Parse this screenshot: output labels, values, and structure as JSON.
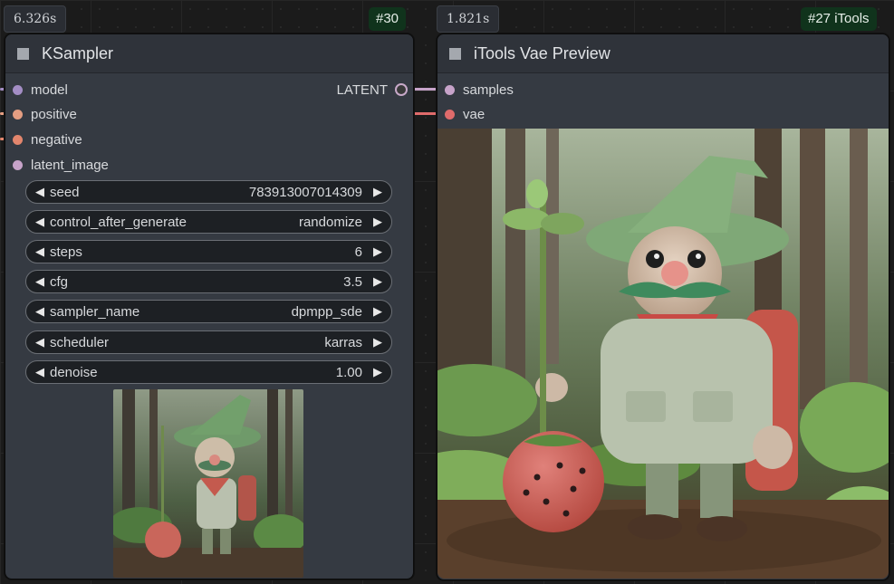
{
  "colors": {
    "model": "#a38dc4",
    "positive": "#e59e82",
    "negative": "#e3866d",
    "latent": "#c7a3c9",
    "vae": "#e06b6b",
    "id_badge_bg": "#10331c"
  },
  "ksampler": {
    "time": "6.326s",
    "id": "#30",
    "title": "KSampler",
    "inputs": [
      "model",
      "positive",
      "negative",
      "latent_image"
    ],
    "output": "LATENT",
    "widgets": [
      {
        "label": "seed",
        "value": "783913007014309"
      },
      {
        "label": "control_after_generate",
        "value": "randomize"
      },
      {
        "label": "steps",
        "value": "6"
      },
      {
        "label": "cfg",
        "value": "3.5"
      },
      {
        "label": "sampler_name",
        "value": "dpmpp_sde"
      },
      {
        "label": "scheduler",
        "value": "karras"
      },
      {
        "label": "denoise",
        "value": "1.00"
      }
    ],
    "preview_alt": "gnome-with-strawberry-thumbnail"
  },
  "vae_preview": {
    "time": "1.821s",
    "id": "#27 iTools",
    "title": "iTools Vae Preview",
    "inputs": [
      "samples",
      "vae"
    ],
    "preview_alt": "gnome-with-strawberry-image"
  }
}
